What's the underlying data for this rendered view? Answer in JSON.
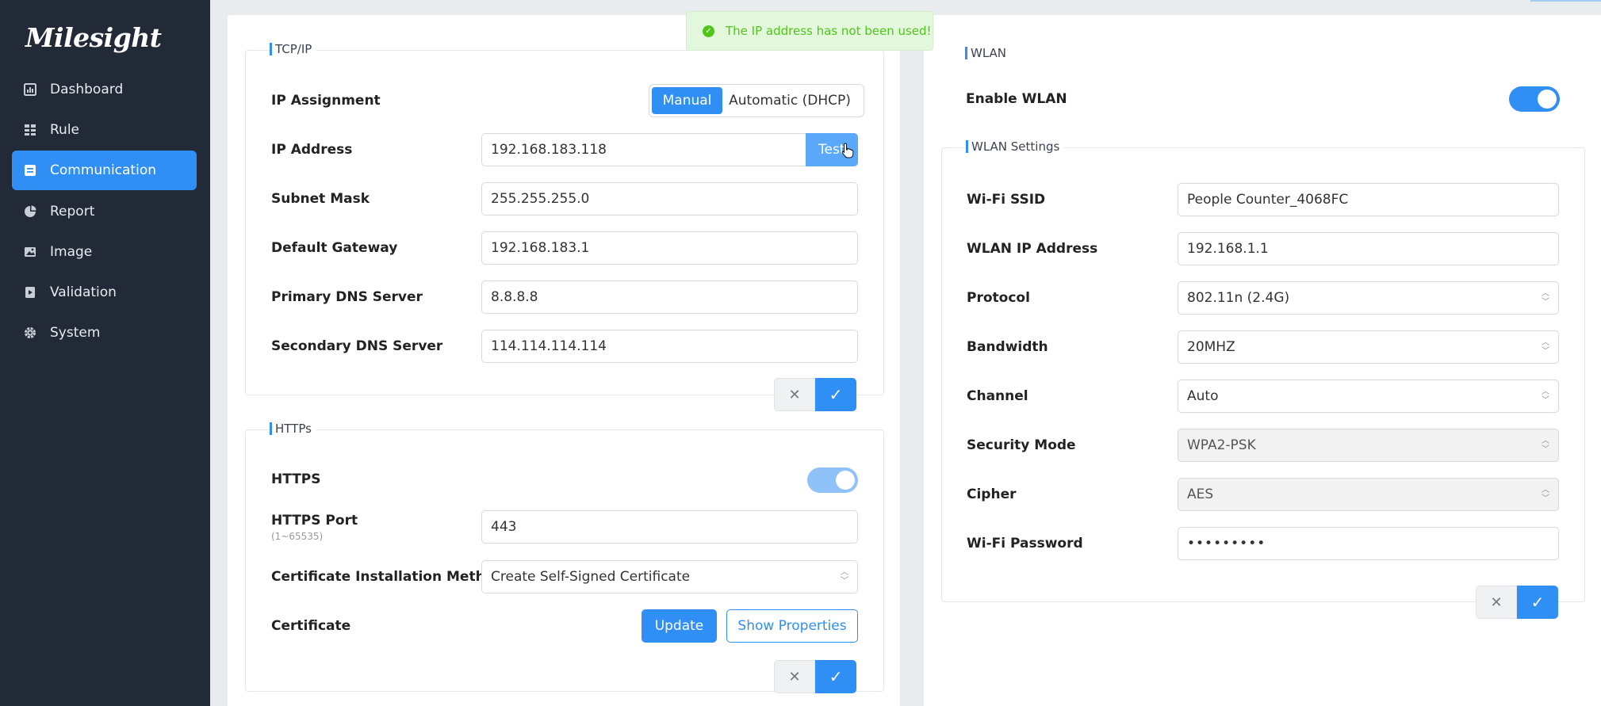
{
  "brand": {
    "logo_text": "Milesight",
    "accent": "#2f8ff5"
  },
  "sidebar": {
    "items": [
      {
        "label": "Dashboard",
        "icon": "dashboard-icon",
        "active": false
      },
      {
        "label": "Rule",
        "icon": "rule-icon",
        "active": false
      },
      {
        "label": "Communication",
        "icon": "communication-icon",
        "active": true
      },
      {
        "label": "Report",
        "icon": "report-icon",
        "active": false
      },
      {
        "label": "Image",
        "icon": "image-icon",
        "active": false
      },
      {
        "label": "Validation",
        "icon": "validation-icon",
        "active": false
      },
      {
        "label": "System",
        "icon": "gear-icon",
        "active": false
      }
    ]
  },
  "toast": {
    "message": "The IP address has not been used!"
  },
  "tcpip": {
    "legend": "TCP/IP",
    "ip_assignment_label": "IP Assignment",
    "mode_manual": "Manual",
    "mode_dhcp": "Automatic (DHCP)",
    "ip_address_label": "IP Address",
    "ip_address": "192.168.183.118",
    "test_label": "Test",
    "subnet_label": "Subnet Mask",
    "subnet": "255.255.255.0",
    "gateway_label": "Default Gateway",
    "gateway": "192.168.183.1",
    "dns1_label": "Primary DNS Server",
    "dns1": "8.8.8.8",
    "dns2_label": "Secondary DNS Server",
    "dns2": "114.114.114.114"
  },
  "https": {
    "legend": "HTTPs",
    "https_label": "HTTPS",
    "https_enabled": true,
    "port_label": "HTTPS Port",
    "port_hint": "(1~65535)",
    "port": "443",
    "cert_method_label": "Certificate Installation Method",
    "cert_method": "Create Self-Signed Certificate",
    "cert_label": "Certificate",
    "update_label": "Update",
    "show_props_label": "Show Properties"
  },
  "wlan": {
    "legend": "WLAN",
    "enable_label": "Enable WLAN",
    "enabled": true,
    "settings_legend": "WLAN Settings",
    "ssid_label": "Wi-Fi SSID",
    "ssid": "People Counter_4068FC",
    "ip_label": "WLAN IP Address",
    "ip": "192.168.1.1",
    "protocol_label": "Protocol",
    "protocol": "802.11n (2.4G)",
    "bandwidth_label": "Bandwidth",
    "bandwidth": "20MHZ",
    "channel_label": "Channel",
    "channel": "Auto",
    "security_label": "Security Mode",
    "security": "WPA2-PSK",
    "cipher_label": "Cipher",
    "cipher": "AES",
    "password_label": "Wi-Fi Password",
    "password": "•••••••••"
  },
  "actions": {
    "cancel_icon": "close-icon",
    "confirm_icon": "check-icon"
  }
}
